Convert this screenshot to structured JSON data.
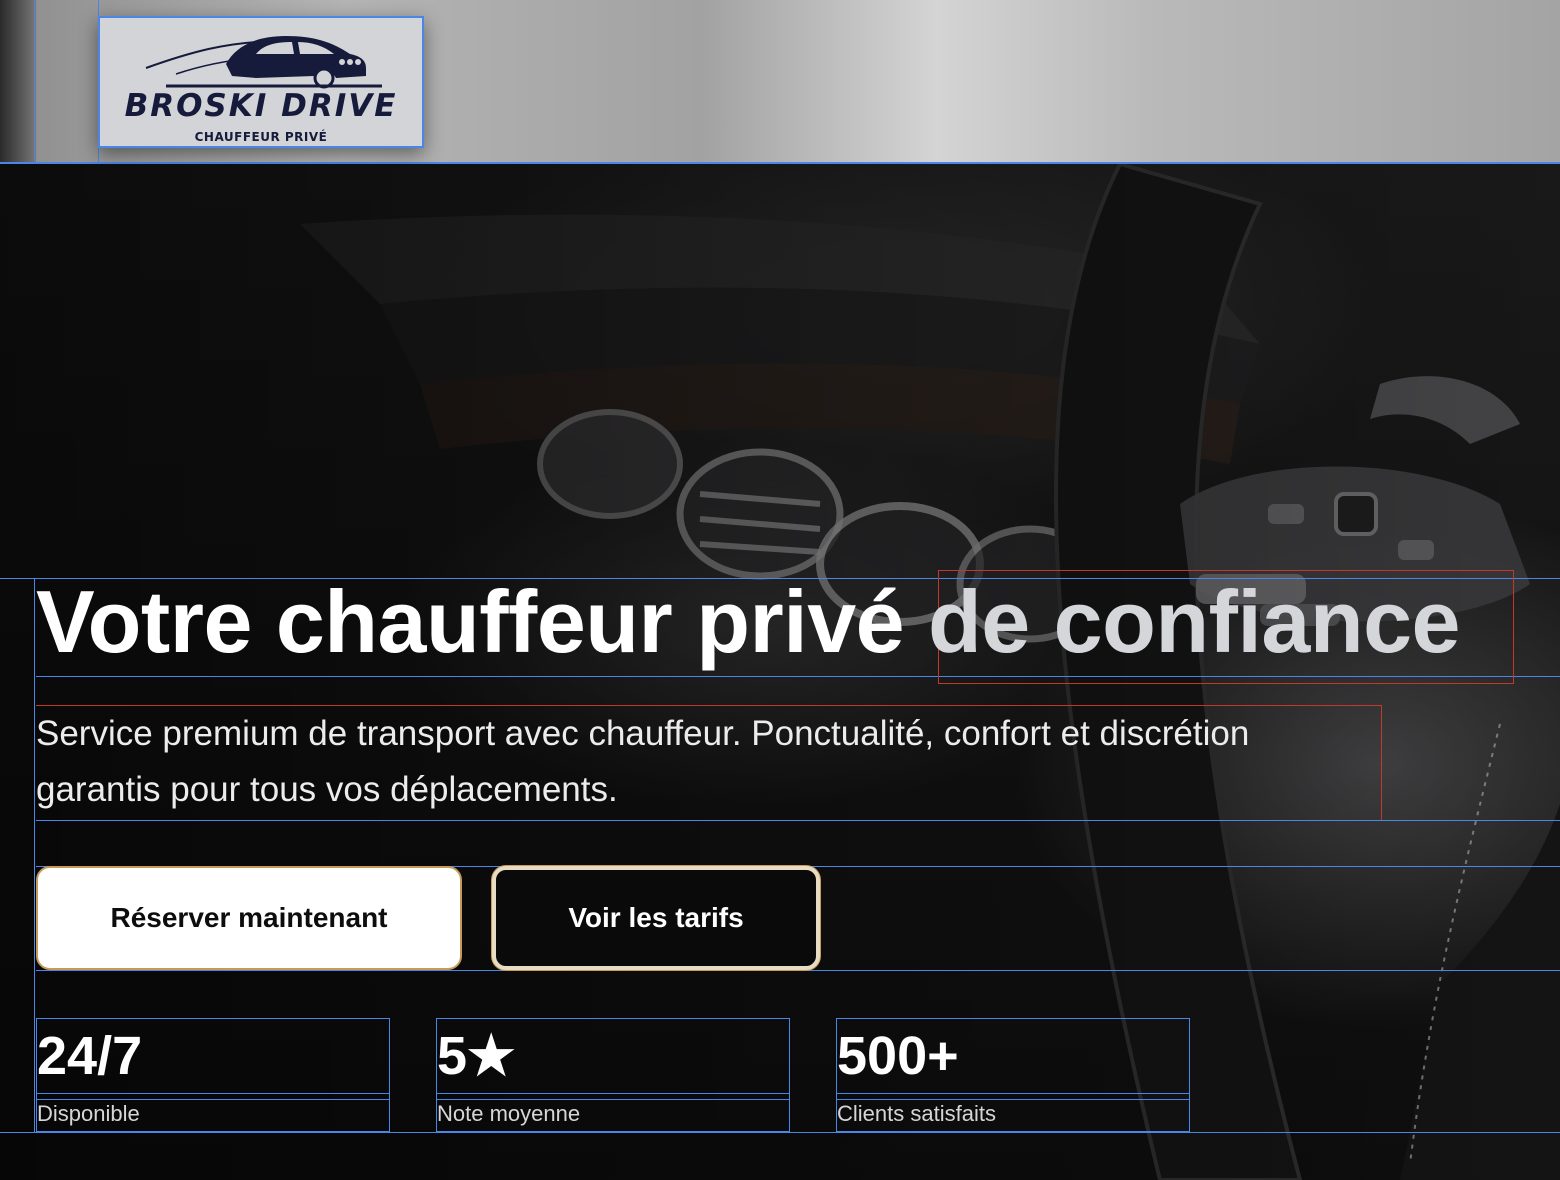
{
  "brand": {
    "name": "BROSKI DRIVE",
    "tagline": "CHAUFFEUR PRIVÉ",
    "logo_icon": "car-icon"
  },
  "hero": {
    "title_main": "Votre chauffeur privé ",
    "title_accent": "de confiance",
    "description": "Service premium de transport avec chauffeur. Ponctualité, confort et discrétion garantis pour tous vos déplacements.",
    "background": "car-interior-steering-wheel-photo"
  },
  "buttons": {
    "primary_label": "Réserver maintenant",
    "secondary_label": "Voir les tarifs"
  },
  "stats": [
    {
      "value": "24/7",
      "label": "Disponible"
    },
    {
      "value": "5★",
      "label": "Note moyenne"
    },
    {
      "value": "500+",
      "label": "Clients satisfaits"
    }
  ],
  "colors": {
    "accent_gold": "#c79a57",
    "guide_blue": "#4a86e8",
    "brand_navy": "#161a3b"
  }
}
